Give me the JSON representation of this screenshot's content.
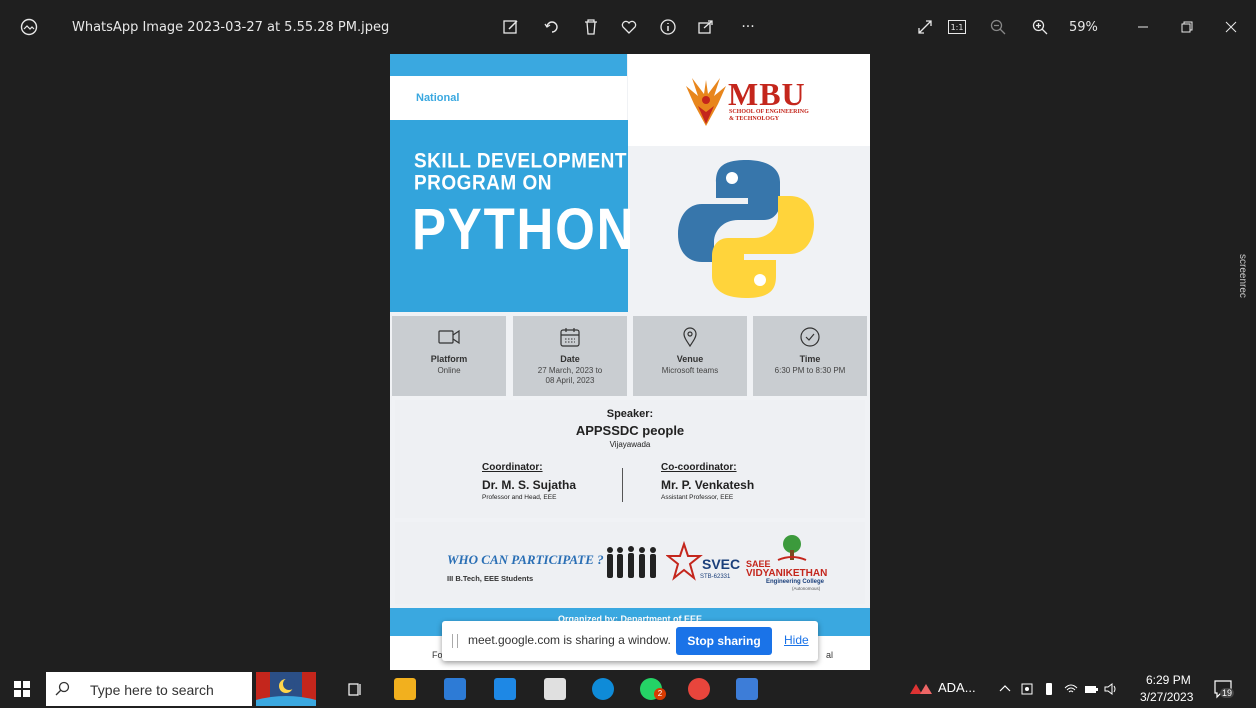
{
  "window": {
    "title": "WhatsApp Image 2023-03-27 at 5.55.28 PM.jpeg",
    "zoom": "59%"
  },
  "toolbar": {
    "icons": [
      "edit-icon",
      "rotate-icon",
      "delete-icon",
      "heart-icon",
      "info-icon",
      "share-icon",
      "more-icon",
      "fullscreen-icon",
      "actual-size-icon",
      "zoom-out-icon",
      "zoom-in-icon",
      "minimize-icon",
      "restore-icon",
      "close-icon"
    ],
    "more_label": "···",
    "actual_size_label": "1:1"
  },
  "poster": {
    "national": "National",
    "title_line1": "SKILL DEVELOPMENT",
    "title_line2": "PROGRAM ON",
    "title_big": "PYTHON",
    "logo_text": "MBU",
    "logo_sub1": "SCHOOL OF ENGINEERING",
    "logo_sub2": "& TECHNOLOGY",
    "info": [
      {
        "label": "Platform",
        "value": "Online",
        "value2": "",
        "icon": "video-icon"
      },
      {
        "label": "Date",
        "value": "27 March, 2023 to",
        "value2": "08 April, 2023",
        "icon": "calendar-icon"
      },
      {
        "label": "Venue",
        "value": "Microsoft teams",
        "value2": "",
        "icon": "location-icon"
      },
      {
        "label": "Time",
        "value": "6:30 PM to 8:30 PM",
        "value2": "",
        "icon": "clock-icon"
      }
    ],
    "speaker_heading": "Speaker:",
    "speaker_name": "APPSSDC people",
    "speaker_place": "Vijayawada",
    "coordinator_heading": "Coordinator:",
    "coordinator_name": "Dr. M. S. Sujatha",
    "coordinator_role": "Professor and Head, EEE",
    "cocoordinator_heading": "Co-coordinator:",
    "cocoordinator_name": "Mr. P. Venkatesh",
    "cocoordinator_role": "Assistant Professor, EEE",
    "who": "WHO CAN PARTICIPATE ?",
    "who_sub": "III B.Tech, EEE Students",
    "svec": "SVEC",
    "svec_sub": "STB-62331",
    "saee1": "SAEE",
    "saee2": "VIDYANIKETHAN",
    "saee3": "Engineering College",
    "saee4": "(Autonomous)",
    "organized": "Organized by: Department of EEE",
    "bottom_left": "Fo",
    "bottom_right": "al"
  },
  "share_bar": {
    "message": "meet.google.com is sharing a window.",
    "stop_label": "Stop sharing",
    "hide_label": "Hide"
  },
  "watermark": "screenrec",
  "taskbar": {
    "search_placeholder": "Type here to search",
    "badge_count": "2",
    "tray_app": "ADA...",
    "time": "6:29 PM",
    "date": "3/27/2023",
    "notification_count": "19"
  },
  "colors": {
    "poster_blue": "#33a4dc",
    "mbu_red": "#c4261c",
    "stop_blue": "#1a73e8"
  }
}
